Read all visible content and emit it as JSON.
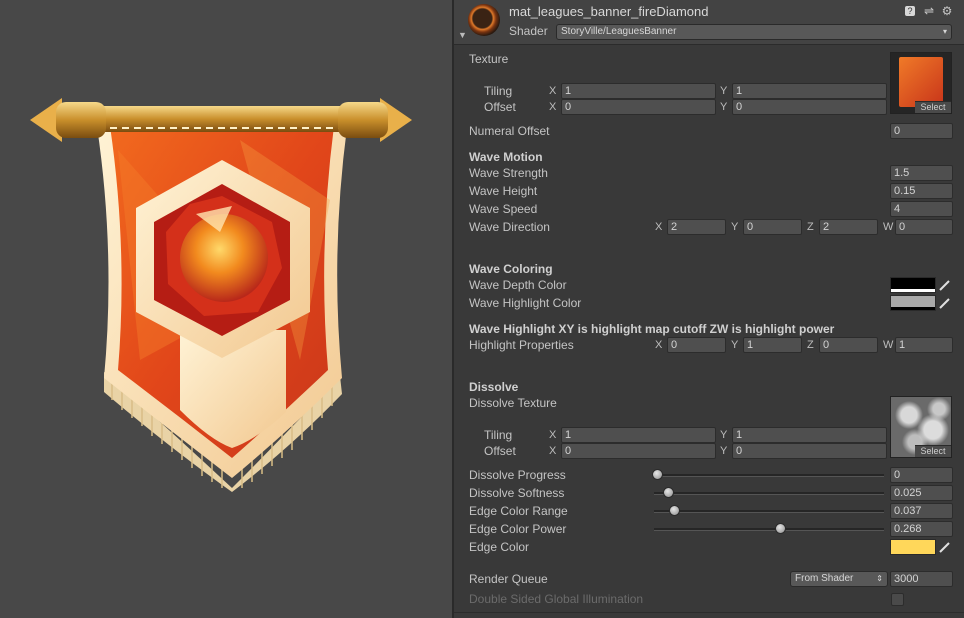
{
  "material_name": "mat_leagues_banner_fireDiamond",
  "shader": {
    "label": "Shader",
    "value": "StoryVille/LeaguesBanner"
  },
  "header_icons": [
    "help-icon",
    "settings-sliders-icon",
    "gear-icon"
  ],
  "texture": {
    "label": "Texture",
    "tiling_label": "Tiling",
    "offset_label": "Offset",
    "tiling": {
      "x": "1",
      "y": "1"
    },
    "offset": {
      "x": "0",
      "y": "0"
    },
    "select_label": "Select"
  },
  "numeral_offset": {
    "label": "Numeral Offset",
    "value": "0"
  },
  "wave_motion": {
    "title": "Wave Motion",
    "strength": {
      "label": "Wave Strength",
      "value": "1.5"
    },
    "height": {
      "label": "Wave Height",
      "value": "0.15"
    },
    "speed": {
      "label": "Wave Speed",
      "value": "4"
    },
    "direction": {
      "label": "Wave Direction",
      "x": "2",
      "y": "0",
      "z": "2",
      "w": "0"
    }
  },
  "wave_coloring": {
    "title": "Wave Coloring",
    "depth_label": "Wave Depth Color",
    "highlight_label": "Wave Highlight Color",
    "depth_color": "#000000",
    "highlight_color": "#a9a9a9"
  },
  "highlight": {
    "note": "Wave Highlight XY is highlight map cutoff ZW is highlight power",
    "label": "Highlight Properties",
    "x": "0",
    "y": "1",
    "z": "0",
    "w": "1"
  },
  "dissolve": {
    "title": "Dissolve",
    "texture_label": "Dissolve Texture",
    "tiling_label": "Tiling",
    "offset_label": "Offset",
    "tiling": {
      "x": "1",
      "y": "1"
    },
    "offset": {
      "x": "0",
      "y": "0"
    },
    "select_label": "Select",
    "sliders": [
      {
        "label": "Dissolve Progress",
        "value": "0",
        "fraction": 0.0
      },
      {
        "label": "Dissolve Softness",
        "value": "0.025",
        "fraction": 0.05
      },
      {
        "label": "Edge Color Range",
        "value": "0.037",
        "fraction": 0.074
      },
      {
        "label": "Edge Color Power",
        "value": "0.268",
        "fraction": 0.536
      }
    ],
    "edge_color_label": "Edge Color",
    "edge_color": "#ffd75a"
  },
  "render_queue": {
    "label": "Render Queue",
    "mode": "From Shader",
    "value": "3000"
  },
  "double_sided_gi": {
    "label": "Double Sided Global Illumination",
    "checked": false
  },
  "axis_labels": {
    "x": "X",
    "y": "Y",
    "z": "Z",
    "w": "W"
  }
}
